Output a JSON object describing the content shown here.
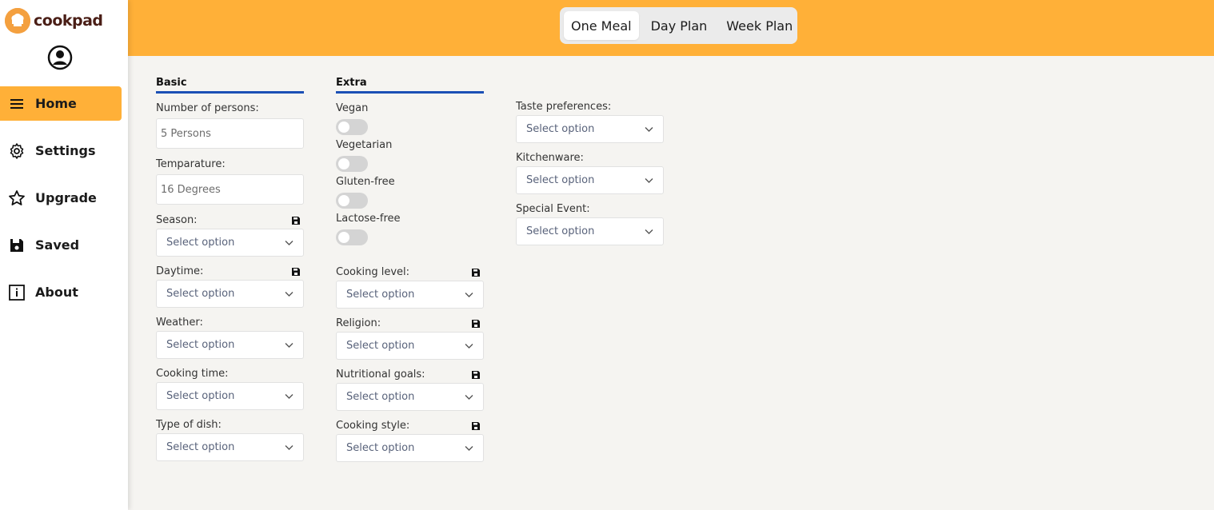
{
  "brand": {
    "name": "cookpad",
    "color": "#f4a03f"
  },
  "sidebar": {
    "items": [
      {
        "label": "Home",
        "icon": "menu-icon",
        "active": true
      },
      {
        "label": "Settings",
        "icon": "gear-icon"
      },
      {
        "label": "Upgrade",
        "icon": "star-icon"
      },
      {
        "label": "Saved",
        "icon": "save-icon"
      },
      {
        "label": "About",
        "icon": "info-icon"
      }
    ]
  },
  "header": {
    "tabs": [
      {
        "label": "One Meal",
        "active": true
      },
      {
        "label": "Day Plan"
      },
      {
        "label": "Week Plan"
      }
    ],
    "color": "#ffb038"
  },
  "form": {
    "basic": {
      "heading": "Basic",
      "persons_label": "Number of persons:",
      "persons_placeholder": "5 Persons",
      "temp_label": "Temparature:",
      "temp_placeholder": "16 Degrees",
      "season_label": "Season:",
      "daytime_label": "Daytime:",
      "weather_label": "Weather:",
      "cooking_time_label": "Cooking time:",
      "dish_type_label": "Type of dish:"
    },
    "extra": {
      "heading": "Extra",
      "vegan_label": "Vegan",
      "vegetarian_label": "Vegetarian",
      "gluten_label": "Gluten-free",
      "lactose_label": "Lactose-free",
      "cooking_level_label": "Cooking level:",
      "religion_label": "Religion:",
      "nutrition_label": "Nutritional goals:",
      "cooking_style_label": "Cooking style:"
    },
    "more": {
      "taste_label": "Taste preferences:",
      "kitchenware_label": "Kitchenware:",
      "event_label": "Special Event:"
    },
    "select_placeholder": "Select option",
    "accent_color": "#1b4fb5"
  }
}
